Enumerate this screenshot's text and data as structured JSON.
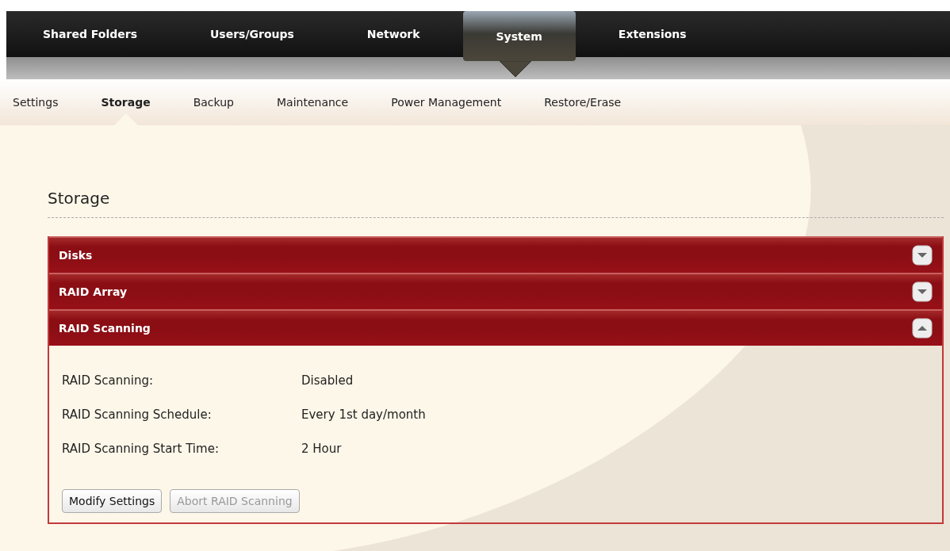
{
  "main_tabs": [
    {
      "label": "Shared Folders",
      "selected": false
    },
    {
      "label": "Users/Groups",
      "selected": false
    },
    {
      "label": "Network",
      "selected": false
    },
    {
      "label": "System",
      "selected": true
    },
    {
      "label": "Extensions",
      "selected": false
    }
  ],
  "sub_tabs": [
    {
      "label": "Settings",
      "selected": false
    },
    {
      "label": "Storage",
      "selected": true
    },
    {
      "label": "Backup",
      "selected": false
    },
    {
      "label": "Maintenance",
      "selected": false
    },
    {
      "label": "Power Management",
      "selected": false
    },
    {
      "label": "Restore/Erase",
      "selected": false
    }
  ],
  "page_title": "Storage",
  "sections": [
    {
      "title": "Disks",
      "expanded": false
    },
    {
      "title": "RAID Array",
      "expanded": false
    },
    {
      "title": "RAID Scanning",
      "expanded": true,
      "fields": [
        {
          "label": "RAID Scanning:",
          "value": "Disabled"
        },
        {
          "label": "RAID Scanning Schedule:",
          "value": "Every 1st day/month"
        },
        {
          "label": "RAID Scanning Start Time:",
          "value": "2 Hour"
        }
      ],
      "buttons": [
        {
          "label": "Modify Settings",
          "disabled": false
        },
        {
          "label": "Abort RAID Scanning",
          "disabled": true
        }
      ]
    }
  ]
}
